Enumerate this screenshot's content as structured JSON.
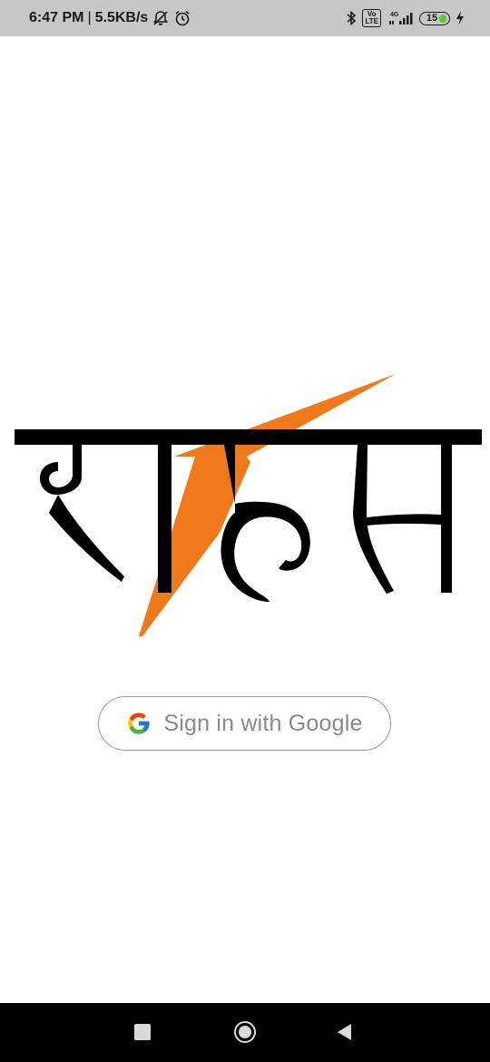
{
  "status_bar": {
    "time": "6:47 PM",
    "separator": "|",
    "network_speed": "5.5KB/s",
    "icons_left": [
      "notifications-off-icon",
      "alarm-icon"
    ],
    "icons_right": [
      "bluetooth-icon",
      "volte-icon",
      "signal-4g-icon",
      "battery-icon",
      "charging-icon"
    ],
    "volte_label": "Vo\nLTE",
    "network_type": "4G",
    "battery_level": "15",
    "battery_color": "#63c53e"
  },
  "logo": {
    "text": "राहत",
    "accent_color": "#f07a1a",
    "text_color": "#000000"
  },
  "sign_in": {
    "label": "Sign in with Google",
    "icon": "google-g-icon"
  },
  "nav_bar": {
    "buttons": [
      "recent-apps",
      "home",
      "back"
    ]
  }
}
